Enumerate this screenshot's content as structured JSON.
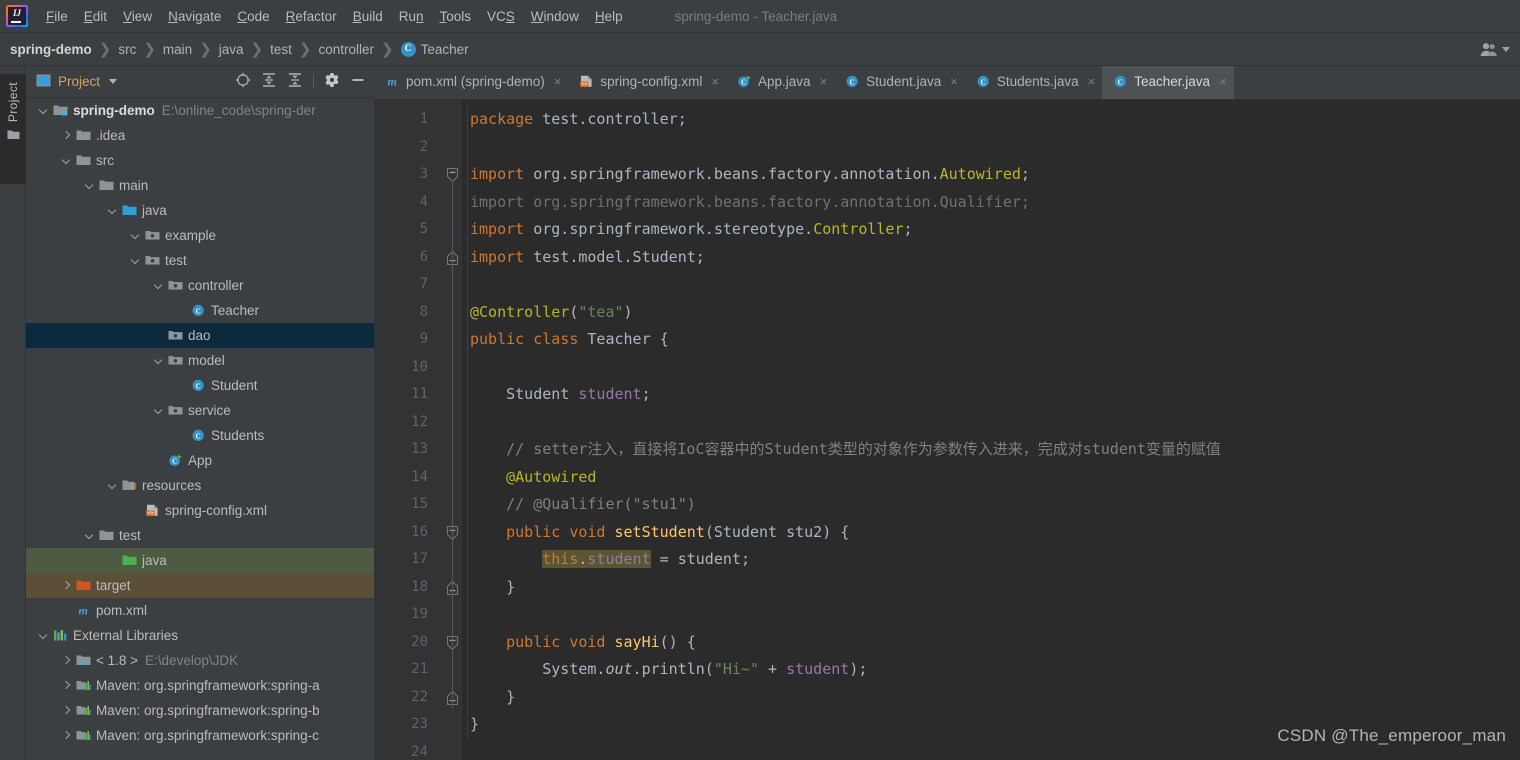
{
  "window": {
    "title": "spring-demo - Teacher.java",
    "app_icon": "intellij-idea-logo"
  },
  "menubar": {
    "items": [
      {
        "label": "File",
        "mnemonic": "F"
      },
      {
        "label": "Edit",
        "mnemonic": "E"
      },
      {
        "label": "View",
        "mnemonic": "V"
      },
      {
        "label": "Navigate",
        "mnemonic": "N"
      },
      {
        "label": "Code",
        "mnemonic": "C"
      },
      {
        "label": "Refactor",
        "mnemonic": "R"
      },
      {
        "label": "Build",
        "mnemonic": "B"
      },
      {
        "label": "Run",
        "mnemonic": "n"
      },
      {
        "label": "Tools",
        "mnemonic": "T"
      },
      {
        "label": "VCS",
        "mnemonic": "S"
      },
      {
        "label": "Window",
        "mnemonic": "W"
      },
      {
        "label": "Help",
        "mnemonic": "H"
      }
    ]
  },
  "navbar": {
    "crumbs": [
      "spring-demo",
      "src",
      "main",
      "java",
      "test",
      "controller",
      "Teacher"
    ],
    "class_badge": "C",
    "right_icon": "people-icon",
    "right_caret": "chevron-down-icon"
  },
  "toolwindow_strip": {
    "project_tab": "Project",
    "project_tab_icon": "folder-icon"
  },
  "project_panel": {
    "title": "Project",
    "title_icon": "project-view-icon",
    "caret_icon": "chevron-down-icon",
    "tools": [
      "locate-icon",
      "expand-all-icon",
      "collapse-all-icon",
      "settings-gear-icon",
      "hide-icon"
    ],
    "tree": [
      {
        "label": "spring-demo",
        "path": "E:\\online_code\\spring-der",
        "depth": 0,
        "icon": "module-folder-icon",
        "arrow": "open",
        "bold": true,
        "state": "none"
      },
      {
        "label": ".idea",
        "path": "",
        "depth": 1,
        "icon": "folder-icon",
        "arrow": "closed",
        "bold": false,
        "state": "none"
      },
      {
        "label": "src",
        "path": "",
        "depth": 1,
        "icon": "folder-icon",
        "arrow": "open",
        "bold": false,
        "state": "none"
      },
      {
        "label": "main",
        "path": "",
        "depth": 2,
        "icon": "folder-icon",
        "arrow": "open",
        "bold": false,
        "state": "none"
      },
      {
        "label": "java",
        "path": "",
        "depth": 3,
        "icon": "source-root-icon",
        "arrow": "open",
        "bold": false,
        "state": "none"
      },
      {
        "label": "example",
        "path": "",
        "depth": 4,
        "icon": "package-icon",
        "arrow": "open",
        "bold": false,
        "state": "none"
      },
      {
        "label": "test",
        "path": "",
        "depth": 4,
        "icon": "package-icon",
        "arrow": "open",
        "bold": false,
        "state": "none"
      },
      {
        "label": "controller",
        "path": "",
        "depth": 5,
        "icon": "package-icon",
        "arrow": "open",
        "bold": false,
        "state": "none"
      },
      {
        "label": "Teacher",
        "path": "",
        "depth": 6,
        "icon": "java-class-icon",
        "arrow": "none",
        "bold": false,
        "state": "none"
      },
      {
        "label": "dao",
        "path": "",
        "depth": 5,
        "icon": "package-icon",
        "arrow": "none",
        "bold": false,
        "state": "selected"
      },
      {
        "label": "model",
        "path": "",
        "depth": 5,
        "icon": "package-icon",
        "arrow": "open",
        "bold": false,
        "state": "none"
      },
      {
        "label": "Student",
        "path": "",
        "depth": 6,
        "icon": "java-class-icon",
        "arrow": "none",
        "bold": false,
        "state": "none"
      },
      {
        "label": "service",
        "path": "",
        "depth": 5,
        "icon": "package-icon",
        "arrow": "open",
        "bold": false,
        "state": "none"
      },
      {
        "label": "Students",
        "path": "",
        "depth": 6,
        "icon": "java-class-icon",
        "arrow": "none",
        "bold": false,
        "state": "none"
      },
      {
        "label": "App",
        "path": "",
        "depth": 5,
        "icon": "java-runnable-class-icon",
        "arrow": "none",
        "bold": false,
        "state": "none"
      },
      {
        "label": "resources",
        "path": "",
        "depth": 3,
        "icon": "resource-root-icon",
        "arrow": "open",
        "bold": false,
        "state": "none"
      },
      {
        "label": "spring-config.xml",
        "path": "",
        "depth": 4,
        "icon": "spring-xml-icon",
        "arrow": "none",
        "bold": false,
        "state": "none"
      },
      {
        "label": "test",
        "path": "",
        "depth": 2,
        "icon": "folder-icon",
        "arrow": "open",
        "bold": false,
        "state": "none"
      },
      {
        "label": "java",
        "path": "",
        "depth": 3,
        "icon": "test-source-root-icon",
        "arrow": "none",
        "bold": false,
        "state": "green"
      },
      {
        "label": "target",
        "path": "",
        "depth": 1,
        "icon": "excluded-folder-icon",
        "arrow": "closed",
        "bold": false,
        "state": "brown"
      },
      {
        "label": "pom.xml",
        "path": "",
        "depth": 1,
        "icon": "maven-icon",
        "arrow": "none",
        "bold": false,
        "state": "none"
      },
      {
        "label": "External Libraries",
        "path": "",
        "depth": 0,
        "icon": "libraries-icon",
        "arrow": "open",
        "bold": false,
        "state": "none"
      },
      {
        "label": "< 1.8 >",
        "path": "E:\\develop\\JDK",
        "depth": 1,
        "icon": "jdk-icon",
        "arrow": "closed",
        "bold": false,
        "state": "none"
      },
      {
        "label": "Maven: org.springframework:spring-a",
        "path": "",
        "depth": 1,
        "icon": "maven-library-icon",
        "arrow": "closed",
        "bold": false,
        "state": "none"
      },
      {
        "label": "Maven: org.springframework:spring-b",
        "path": "",
        "depth": 1,
        "icon": "maven-library-icon",
        "arrow": "closed",
        "bold": false,
        "state": "none"
      },
      {
        "label": "Maven: org.springframework:spring-c",
        "path": "",
        "depth": 1,
        "icon": "maven-library-icon",
        "arrow": "closed",
        "bold": false,
        "state": "none"
      }
    ]
  },
  "editor_tabs": [
    {
      "label": "pom.xml (spring-demo)",
      "icon": "maven-icon",
      "active": false,
      "close": "×"
    },
    {
      "label": "spring-config.xml",
      "icon": "spring-xml-icon",
      "active": false,
      "close": "×"
    },
    {
      "label": "App.java",
      "icon": "java-runnable-class-icon",
      "active": false,
      "close": "×"
    },
    {
      "label": "Student.java",
      "icon": "java-class-icon",
      "active": false,
      "close": "×"
    },
    {
      "label": "Students.java",
      "icon": "java-class-icon",
      "active": false,
      "close": "×"
    },
    {
      "label": "Teacher.java",
      "icon": "java-class-icon",
      "active": true,
      "close": "×"
    }
  ],
  "editor": {
    "file": "Teacher.java",
    "caret_line": 23,
    "line_numbers": [
      1,
      2,
      3,
      4,
      5,
      6,
      7,
      8,
      9,
      10,
      11,
      12,
      13,
      14,
      15,
      16,
      17,
      18,
      19,
      20,
      21,
      22,
      23,
      24
    ],
    "folds": [
      {
        "line": 3,
        "type": "fold-open-icon"
      },
      {
        "line": 6,
        "type": "fold-close-icon"
      },
      {
        "line": 16,
        "type": "fold-open-icon"
      },
      {
        "line": 18,
        "type": "fold-close-icon"
      },
      {
        "line": 20,
        "type": "fold-open-icon"
      },
      {
        "line": 22,
        "type": "fold-close-icon"
      }
    ],
    "lines": [
      {
        "n": 1,
        "tokens": [
          {
            "t": "package ",
            "c": "kw"
          },
          {
            "t": "test.controller;",
            "c": "plain"
          }
        ]
      },
      {
        "n": 2,
        "tokens": []
      },
      {
        "n": 3,
        "tokens": [
          {
            "t": "import ",
            "c": "kw"
          },
          {
            "t": "org.springframework.beans.factory.annotation.",
            "c": "plain"
          },
          {
            "t": "Autowired",
            "c": "anno"
          },
          {
            "t": ";",
            "c": "plain"
          }
        ]
      },
      {
        "n": 4,
        "tokens": [
          {
            "t": "import org.springframework.beans.factory.annotation.Qualifier;",
            "c": "dim"
          }
        ]
      },
      {
        "n": 5,
        "tokens": [
          {
            "t": "import ",
            "c": "kw"
          },
          {
            "t": "org.springframework.stereotype.",
            "c": "plain"
          },
          {
            "t": "Controller",
            "c": "anno"
          },
          {
            "t": ";",
            "c": "plain"
          }
        ]
      },
      {
        "n": 6,
        "tokens": [
          {
            "t": "import ",
            "c": "kw"
          },
          {
            "t": "test.model.Student;",
            "c": "plain"
          }
        ]
      },
      {
        "n": 7,
        "tokens": []
      },
      {
        "n": 8,
        "tokens": [
          {
            "t": "@Controller",
            "c": "anno"
          },
          {
            "t": "(",
            "c": "plain"
          },
          {
            "t": "\"tea\"",
            "c": "str"
          },
          {
            "t": ")",
            "c": "plain"
          }
        ]
      },
      {
        "n": 9,
        "tokens": [
          {
            "t": "public class ",
            "c": "kw"
          },
          {
            "t": "Teacher {",
            "c": "plain"
          }
        ]
      },
      {
        "n": 10,
        "tokens": []
      },
      {
        "n": 11,
        "tokens": [
          {
            "t": "    Student ",
            "c": "plain"
          },
          {
            "t": "student",
            "c": "fld"
          },
          {
            "t": ";",
            "c": "plain"
          }
        ]
      },
      {
        "n": 12,
        "tokens": []
      },
      {
        "n": 13,
        "tokens": [
          {
            "t": "    // setter注入，直接将IoC容器中的Student类型的对象作为参数传入进来，完成对student变量的赋值",
            "c": "cmt"
          }
        ]
      },
      {
        "n": 14,
        "tokens": [
          {
            "t": "    @Autowired",
            "c": "anno"
          }
        ]
      },
      {
        "n": 15,
        "tokens": [
          {
            "t": "    // @Qualifier(\"stu1\")",
            "c": "cmt"
          }
        ]
      },
      {
        "n": 16,
        "tokens": [
          {
            "t": "    public void ",
            "c": "kw"
          },
          {
            "t": "setStudent",
            "c": "mth"
          },
          {
            "t": "(",
            "c": "plain"
          },
          {
            "t": "Student",
            "c": "plain"
          },
          {
            "t": " stu2",
            "c": "plain"
          },
          {
            "t": ") {",
            "c": "plain"
          }
        ]
      },
      {
        "n": 17,
        "tokens": [
          {
            "t": "        ",
            "c": "plain"
          },
          {
            "t": "this",
            "c": "kw hl"
          },
          {
            "t": ".",
            "c": "plain hl"
          },
          {
            "t": "student",
            "c": "fld hl"
          },
          {
            "t": " = ",
            "c": "plain"
          },
          {
            "t": "student",
            "c": "plain"
          },
          {
            "t": ";",
            "c": "plain"
          }
        ]
      },
      {
        "n": 18,
        "tokens": [
          {
            "t": "    }",
            "c": "plain"
          }
        ]
      },
      {
        "n": 19,
        "tokens": []
      },
      {
        "n": 20,
        "tokens": [
          {
            "t": "    public void ",
            "c": "kw"
          },
          {
            "t": "sayHi",
            "c": "mth"
          },
          {
            "t": "() {",
            "c": "plain"
          }
        ]
      },
      {
        "n": 21,
        "tokens": [
          {
            "t": "        System.",
            "c": "plain"
          },
          {
            "t": "out",
            "c": "stat"
          },
          {
            "t": ".println(",
            "c": "plain"
          },
          {
            "t": "\"Hi~\"",
            "c": "str"
          },
          {
            "t": " + ",
            "c": "plain"
          },
          {
            "t": "student",
            "c": "fld"
          },
          {
            "t": ");",
            "c": "plain"
          }
        ]
      },
      {
        "n": 22,
        "tokens": [
          {
            "t": "    }",
            "c": "plain"
          }
        ]
      },
      {
        "n": 23,
        "tokens": [
          {
            "t": "}",
            "c": "plain"
          }
        ]
      },
      {
        "n": 24,
        "tokens": []
      }
    ]
  },
  "watermark": {
    "text": "CSDN @The_emperoor_man"
  },
  "colors": {
    "chrome": "#3c3f41",
    "editor_bg": "#2b2b2b",
    "gutter_bg": "#313335",
    "selection_blue": "#0d293e",
    "test_source_green": "#4c5b41",
    "excluded_brown": "#5b4f37",
    "accent_blue": "#3592c4",
    "keyword_orange": "#cc7832",
    "string_green": "#6a8759",
    "annotation_yellow": "#bbb529",
    "method_gold": "#ffc66d",
    "field_purple": "#9876aa",
    "comment_gray": "#808080"
  }
}
